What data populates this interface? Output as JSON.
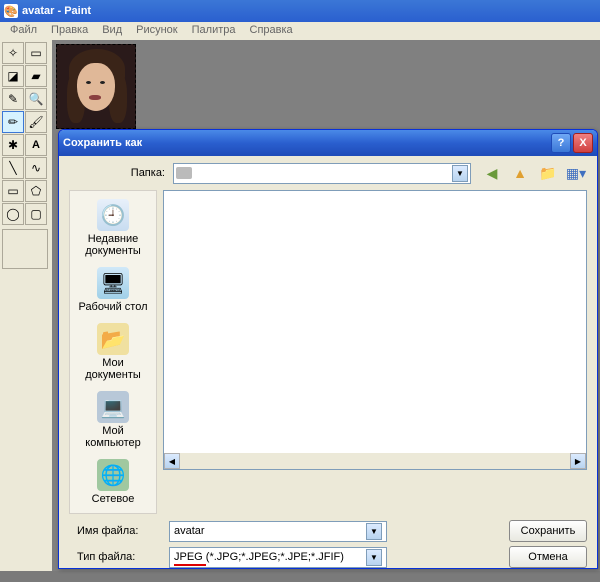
{
  "paint": {
    "title": "avatar - Paint",
    "menu": [
      "Файл",
      "Правка",
      "Вид",
      "Рисунок",
      "Палитра",
      "Справка"
    ]
  },
  "dialog": {
    "title": "Сохранить как",
    "help": "?",
    "close": "X",
    "folder_label": "Папка:",
    "folder_value": "",
    "places": {
      "recent": "Недавние документы",
      "desktop": "Рабочий стол",
      "docs": "Мои документы",
      "computer": "Мой компьютер",
      "network": "Сетевое"
    },
    "filename_label": "Имя файла:",
    "filename_value": "avatar",
    "filetype_label": "Тип файла:",
    "filetype_prefix": "JPEG ",
    "filetype_rest": "(*.JPG;*.JPEG;*.JPE;*.JFIF)",
    "save": "Сохранить",
    "cancel": "Отмена"
  }
}
